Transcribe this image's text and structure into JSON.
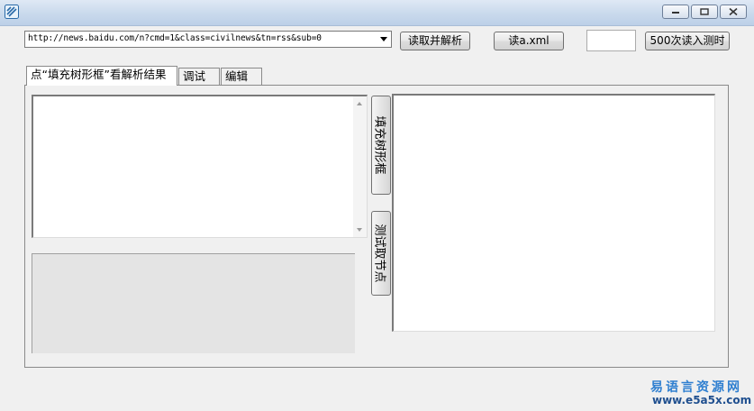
{
  "window": {
    "icon": "app-icon",
    "controls": [
      "minimize-icon",
      "maximize-icon",
      "close-icon"
    ]
  },
  "toolbar": {
    "url_value": "http://news.baidu.com/n?cmd=1&class=civilnews&tn=rss&sub=0",
    "parse_button": "读取并解析",
    "read_xml_button": "读a.xml",
    "count_value": "",
    "read500_button": "500次读入测时"
  },
  "tabs": [
    {
      "label": "点“填充树形框”看解析结果",
      "active": true
    },
    {
      "label": "调试",
      "active": false
    },
    {
      "label": "编辑",
      "active": false
    }
  ],
  "panel": {
    "fill_tree_button": "填充树形框",
    "test_node_button": "测试取节点"
  },
  "watermark": {
    "site_name": "易语言资源网",
    "site_url": "www.e5a5x.com"
  },
  "colors": {
    "titlebar": "#c9d9ec",
    "watermark_cn": "#2f7fd0",
    "watermark_url": "#1f4f8f"
  }
}
